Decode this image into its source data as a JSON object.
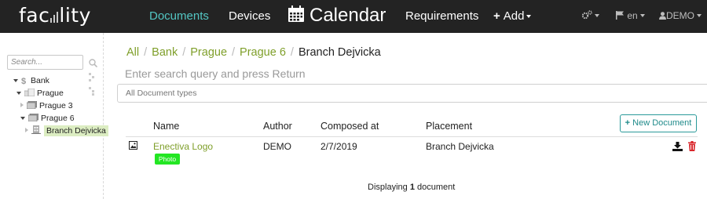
{
  "header": {
    "logo": "facility",
    "nav": [
      "Documents",
      "Devices",
      "Calendar",
      "Requirements",
      "Add"
    ],
    "settings_icon": "gears-icon",
    "language": "en",
    "user": "DEMO",
    "accent": "#53c6c3"
  },
  "sidebar": {
    "search_placeholder": "Search...",
    "tree": [
      {
        "label": "Bank",
        "icon": "bank-icon",
        "expanded": true,
        "level": 0
      },
      {
        "label": "Prague",
        "icon": "city-icon",
        "expanded": true,
        "level": 1
      },
      {
        "label": "Prague 3",
        "icon": "district-icon",
        "expanded": false,
        "level": 2
      },
      {
        "label": "Prague 6",
        "icon": "district-icon",
        "expanded": true,
        "level": 2
      },
      {
        "label": "Branch Dejvicka",
        "icon": "building-icon",
        "expanded": false,
        "selected": true,
        "level": 3
      }
    ]
  },
  "main": {
    "breadcrumb": [
      "All",
      "Bank",
      "Prague",
      "Prague 6",
      "Branch Dejvicka"
    ],
    "search_placeholder": "Enter search query and press Return",
    "doc_types": "All Document types",
    "new_document": "New Document",
    "columns": [
      "Name",
      "Author",
      "Composed at",
      "Placement"
    ],
    "rows": [
      {
        "name": "Enectiva Logo",
        "author": "DEMO",
        "composed": "2/7/2019",
        "placement": "Branch Dejvicka",
        "badge": "Photo",
        "badge_color": "#23e623"
      }
    ],
    "footer_prefix": "Displaying",
    "footer_count": "1",
    "footer_suffix": "document"
  }
}
